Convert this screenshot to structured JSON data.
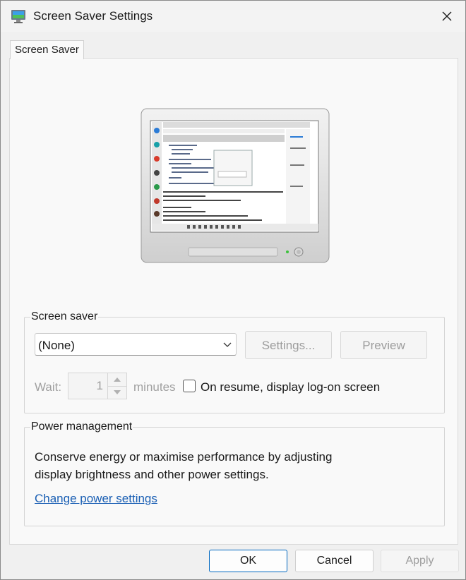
{
  "window": {
    "title": "Screen Saver Settings"
  },
  "tabs": [
    {
      "label": "Screen Saver"
    }
  ],
  "screen_saver": {
    "group_label": "Screen saver",
    "selected": "(None)",
    "settings_label": "Settings...",
    "preview_label": "Preview",
    "wait_label": "Wait:",
    "wait_value": "1",
    "minutes_label": "minutes",
    "resume_label": "On resume, display log-on screen",
    "resume_checked": false
  },
  "power": {
    "group_label": "Power management",
    "description_line1": "Conserve energy or maximise performance by adjusting",
    "description_line2": "display brightness and other power settings.",
    "link_label": "Change power settings"
  },
  "buttons": {
    "ok": "OK",
    "cancel": "Cancel",
    "apply": "Apply"
  },
  "colors": {
    "accent": "#0067c0",
    "link": "#1a5fb4",
    "disabled_text": "#9d9d9d"
  }
}
